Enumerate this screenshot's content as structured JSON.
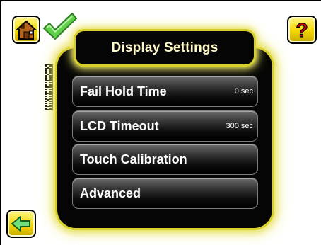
{
  "header": {
    "home_icon": "home-icon",
    "status_icon": "checkmark-icon",
    "help_icon": "help-icon",
    "help_glyph": "?"
  },
  "dialog": {
    "title": "Display Settings",
    "items": [
      {
        "label": "Fail Hold Time",
        "value": "0 sec"
      },
      {
        "label": "LCD Timeout",
        "value": "300 sec"
      },
      {
        "label": "Touch Calibration",
        "value": ""
      },
      {
        "label": "Advanced",
        "value": ""
      }
    ]
  },
  "footer": {
    "back_icon": "back-arrow-icon"
  },
  "colors": {
    "accent_yellow": "#f3d800",
    "glow": "#e6df5a",
    "check_green": "#5fd04a",
    "title_text": "#fff9c8"
  }
}
